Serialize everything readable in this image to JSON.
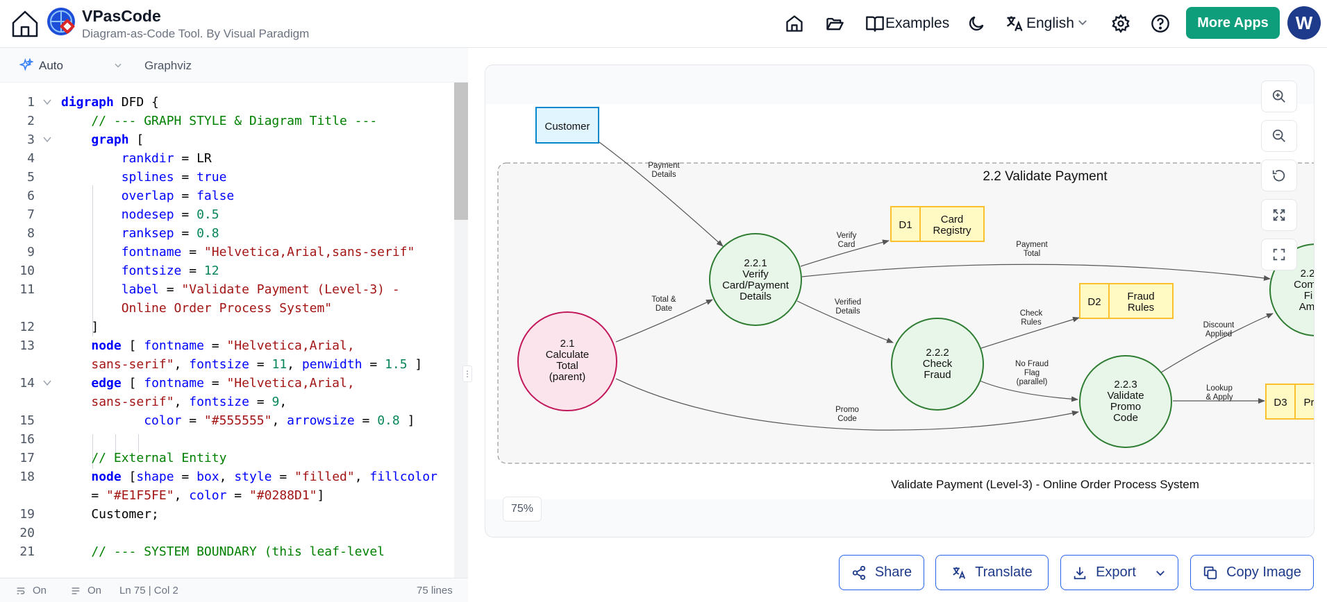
{
  "header": {
    "app_title": "VPasCode",
    "app_subtitle": "Diagram-as-Code Tool. By Visual Paradigm",
    "examples_label": "Examples",
    "language_label": "English",
    "more_apps_label": "More Apps",
    "avatar_initial": "W"
  },
  "editor": {
    "mode_label": "Auto",
    "engine_label": "Graphviz",
    "status": {
      "wrap": "On",
      "minimap": "On",
      "position": "Ln 75 | Col 2",
      "line_count": "75 lines"
    },
    "line_numbers": [
      "1",
      "2",
      "3",
      "4",
      "5",
      "6",
      "7",
      "8",
      "9",
      "10",
      "11",
      "",
      "12",
      "13",
      "",
      "14",
      "",
      "15",
      "16",
      "17",
      "18",
      "",
      "19",
      "20",
      "21"
    ]
  },
  "diagram": {
    "subprocess_title": "2.2 Validate Payment",
    "caption": "Validate Payment (Level-3) - Online Order Process System",
    "zoom_level": "75%",
    "nodes": {
      "customer": "Customer",
      "p21": [
        "2.1",
        "Calculate",
        "Total",
        "(parent)"
      ],
      "p221": [
        "2.2.1",
        "Verify",
        "Card/Payment",
        "Details"
      ],
      "p222": [
        "2.2.2",
        "Check",
        "Fraud"
      ],
      "p223": [
        "2.2.3",
        "Validate",
        "Promo",
        "Code"
      ],
      "p224_partial": [
        "2.2",
        "Com",
        "Fi",
        "Am"
      ],
      "d1_id": "D1",
      "d1_name": [
        "Card",
        "Registry"
      ],
      "d2_id": "D2",
      "d2_name": [
        "Fraud",
        "Rules"
      ],
      "d3_id": "D3",
      "d3_name_partial": "Pr"
    },
    "edge_labels": {
      "payment_details": [
        "Payment",
        "Details"
      ],
      "total_date": [
        "Total &",
        "Date"
      ],
      "verify_card": [
        "Verify",
        "Card"
      ],
      "payment_total": [
        "Payment",
        "Total"
      ],
      "verified_details": [
        "Verified",
        "Details"
      ],
      "check_rules": [
        "Check",
        "Rules"
      ],
      "no_fraud": [
        "No Fraud",
        "Flag",
        "(parallel)"
      ],
      "discount_applied": [
        "Discount",
        "Applied"
      ],
      "lookup_apply": [
        "Lookup",
        "& Apply"
      ],
      "promo_code": [
        "Promo",
        "Code"
      ]
    }
  },
  "actions": {
    "share": "Share",
    "translate": "Translate",
    "export": "Export",
    "copy_image": "Copy Image"
  },
  "colors": {
    "accent_green": "#0f9e7b",
    "avatar_blue": "#1e3a8a",
    "entity_fill": "#E1F5FE",
    "entity_stroke": "#0288D1",
    "process_fill": "#e8f5e9",
    "process_stroke": "#2e7d32",
    "parent_fill": "#fce4ec",
    "parent_stroke": "#c2185b",
    "store_fill": "#fff9c4",
    "store_stroke": "#fbc02d"
  }
}
